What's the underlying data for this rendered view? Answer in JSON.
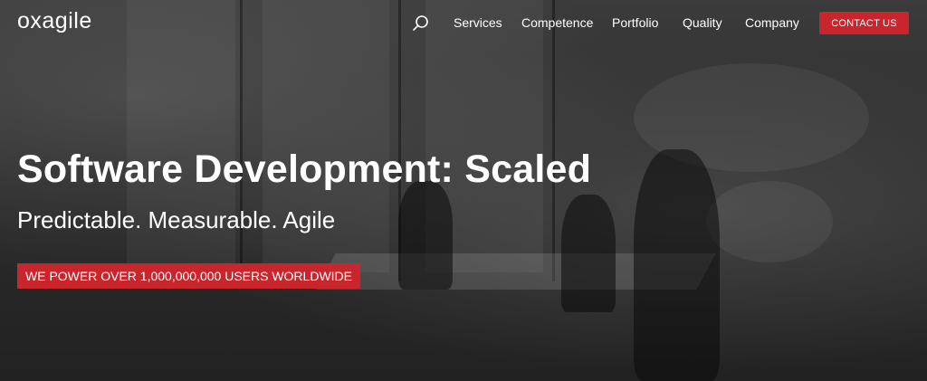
{
  "header": {
    "logo": "oxagile",
    "search_icon": "search-icon",
    "nav": [
      "Services",
      "Competence",
      "Portfolio",
      "Quality",
      "Company"
    ],
    "contact_label": "CONTACT US"
  },
  "hero": {
    "title": "Software Development: Scaled",
    "subtitle": "Predictable. Measurable. Agile",
    "badge": "WE POWER OVER 1,000,000,000 USERS WORLDWIDE"
  },
  "colors": {
    "accent": "#c8262c",
    "text": "#ffffff",
    "background": "#2c2c2c"
  }
}
